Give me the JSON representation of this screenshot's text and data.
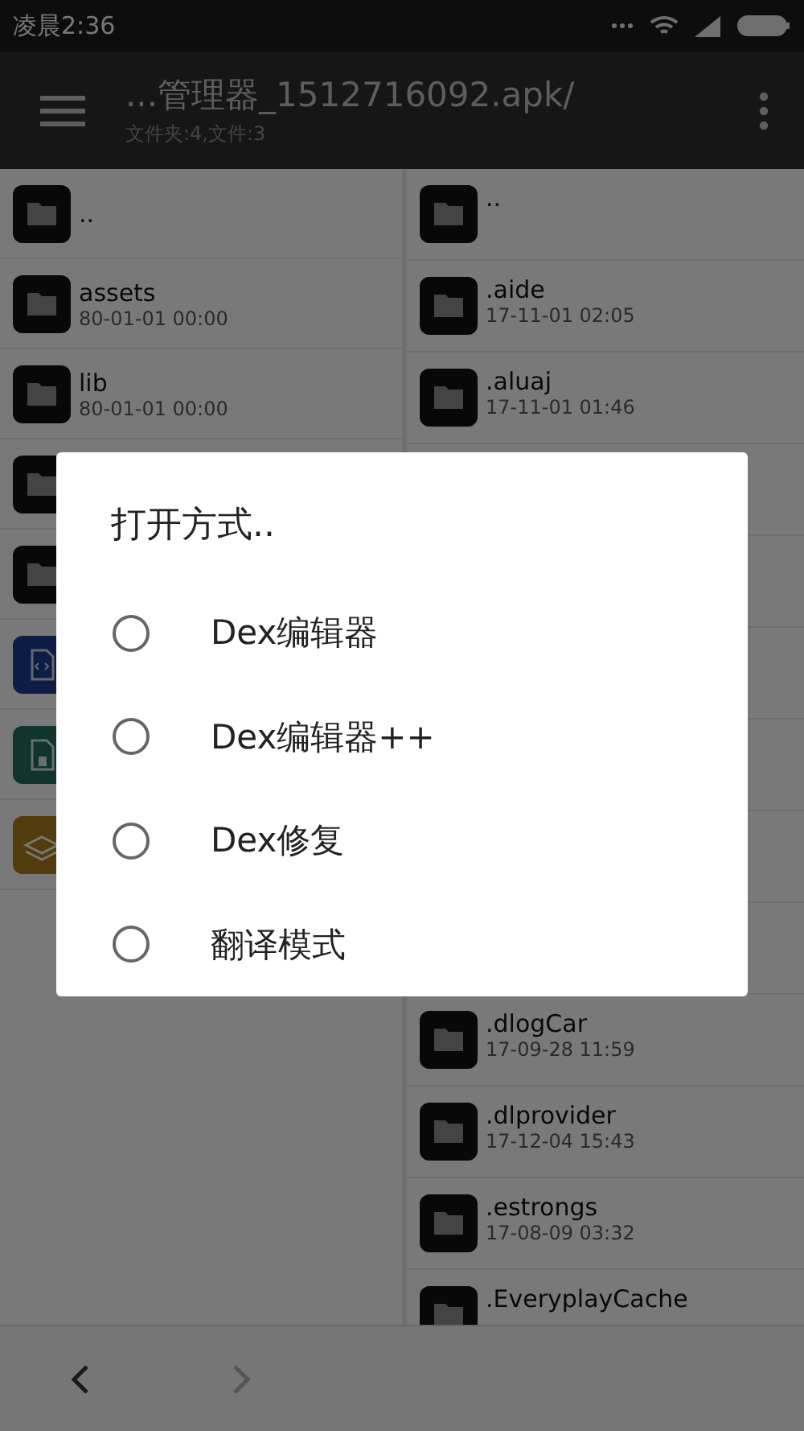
{
  "status_bar": {
    "time": "凌晨2:36"
  },
  "toolbar": {
    "title": "...管理器_1512716092.apk/",
    "subtitle": "文件夹:4,文件:3"
  },
  "left_pane": [
    {
      "kind": "folder",
      "name": ".."
    },
    {
      "kind": "folder",
      "name": "assets",
      "date": "80-01-01 00:00"
    },
    {
      "kind": "folder",
      "name": "lib",
      "date": "80-01-01 00:00"
    },
    {
      "kind": "folder"
    },
    {
      "kind": "folder"
    },
    {
      "kind": "code"
    },
    {
      "kind": "archive"
    },
    {
      "kind": "layers"
    }
  ],
  "right_pane": [
    {
      "kind": "folder",
      "name": ".."
    },
    {
      "kind": "folder",
      "name": ".aide",
      "date": "17-11-01 02:05"
    },
    {
      "kind": "folder",
      "name": ".aluaj",
      "date": "17-11-01 01:46"
    },
    {
      "kind": "covered"
    },
    {
      "kind": "covered"
    },
    {
      "kind": "covered"
    },
    {
      "kind": "covered"
    },
    {
      "kind": "covered"
    },
    {
      "kind": "covered"
    },
    {
      "kind": "folder",
      "name": ".dlogCar",
      "date": "17-09-28 11:59"
    },
    {
      "kind": "folder",
      "name": ".dlprovider",
      "date": "17-12-04 15:43"
    },
    {
      "kind": "folder",
      "name": ".estrongs",
      "date": "17-08-09 03:32"
    },
    {
      "kind": "folder",
      "name": ".EveryplayCache"
    }
  ],
  "bottom_bar": [
    {
      "kind": "back",
      "disabled": false
    },
    {
      "kind": "forward",
      "disabled": true
    }
  ],
  "dialog": {
    "title": "打开方式..",
    "options": [
      {
        "label": "Dex编辑器",
        "selected": false
      },
      {
        "label": "Dex编辑器++",
        "selected": false
      },
      {
        "label": "Dex修复",
        "selected": false
      },
      {
        "label": "翻译模式",
        "selected": false
      }
    ]
  }
}
